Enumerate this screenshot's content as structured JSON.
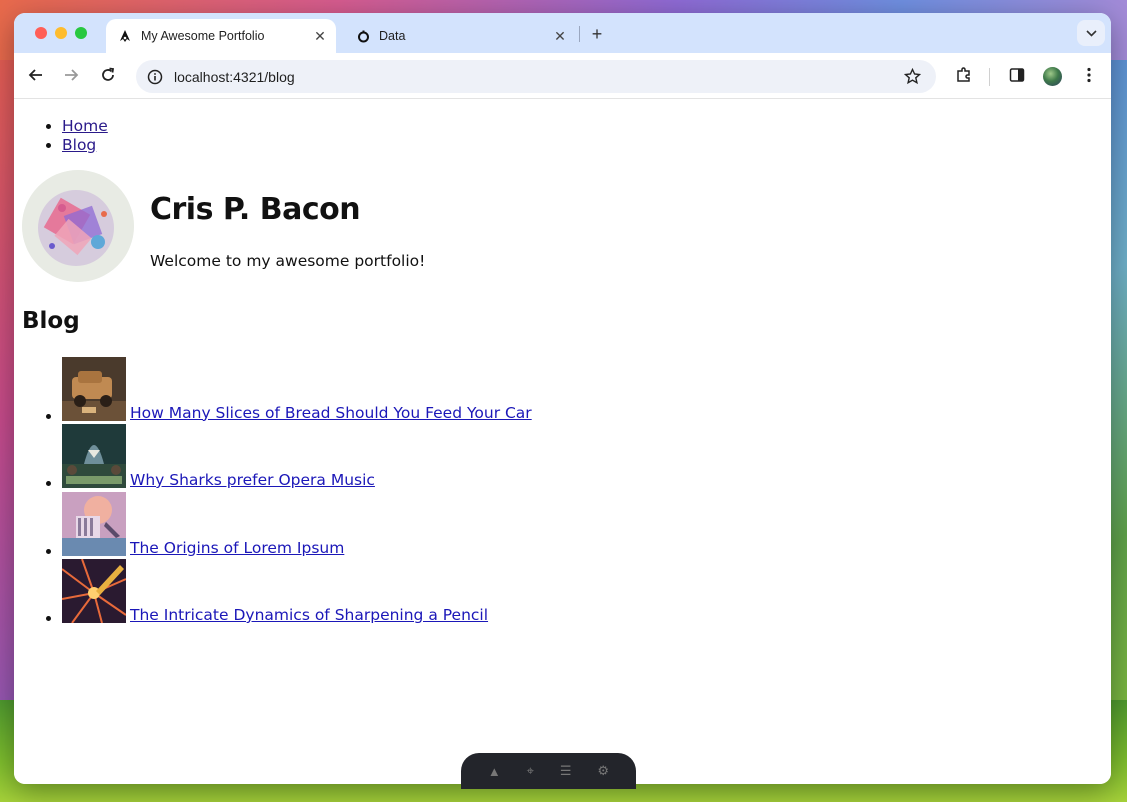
{
  "browser": {
    "tabs": [
      {
        "title": "My Awesome Portfolio",
        "active": true,
        "favicon": "astro-icon"
      },
      {
        "title": "Data",
        "active": false,
        "favicon": "react-icon"
      }
    ],
    "url": "localhost:4321/blog"
  },
  "page": {
    "nav": [
      {
        "label": "Home"
      },
      {
        "label": "Blog"
      }
    ],
    "name": "Cris P. Bacon",
    "tagline": "Welcome to my awesome portfolio!",
    "blog_heading": "Blog",
    "posts": [
      {
        "title": "How Many Slices of Bread Should You Feed Your Car"
      },
      {
        "title": "Why Sharks prefer Opera Music"
      },
      {
        "title": "The Origins of Lorem Ipsum"
      },
      {
        "title": "The Intricate Dynamics of Sharpening a Pencil"
      }
    ]
  },
  "colors": {
    "tabbar": "#d3e3fd",
    "link": "#1b17b8",
    "visited_link": "#2a1a8a"
  }
}
